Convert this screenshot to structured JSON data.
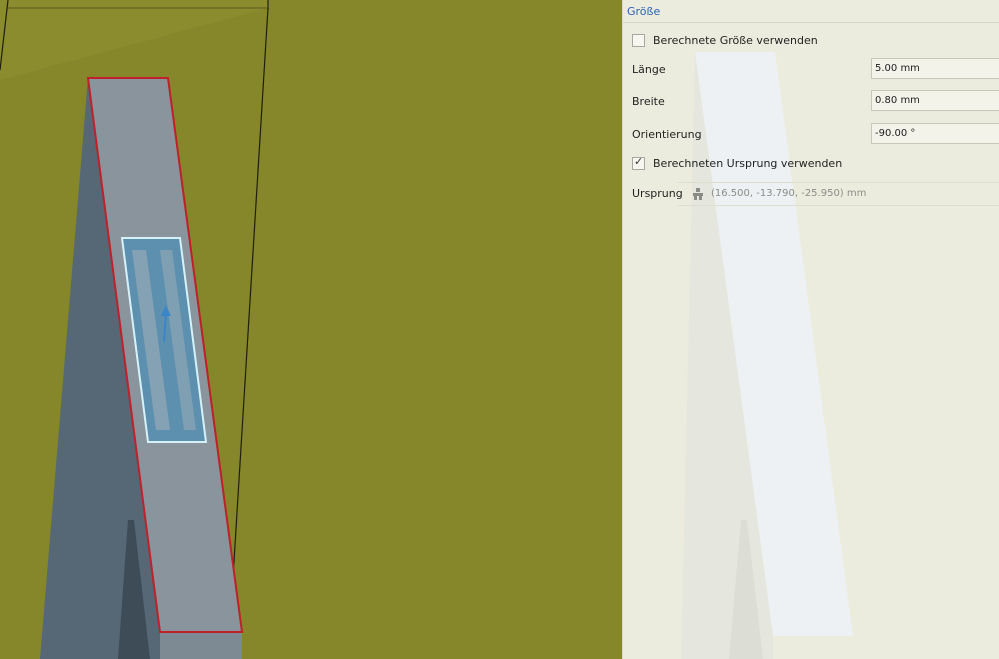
{
  "panel": {
    "section_title": "Größe",
    "use_calculated_size": {
      "label": "Berechnete Größe verwenden",
      "checked": false
    },
    "length": {
      "label": "Länge",
      "value": "5.00 mm"
    },
    "width": {
      "label": "Breite",
      "value": "0.80 mm"
    },
    "orientation": {
      "label": "Orientierung",
      "value": "-90.00 °"
    },
    "use_calculated_origin": {
      "label": "Berechneten Ursprung verwenden",
      "checked": true
    },
    "origin": {
      "label": "Ursprung",
      "value": "(16.500, -13.790, -25.950) mm",
      "icon": "origin-person-icon"
    }
  },
  "colors": {
    "viewport_bg": "#85872a",
    "selection_edge": "#c0202a",
    "pad_highlight": "#bfe8f5",
    "section_title": "#2a62b8",
    "panel_bg": "#ececde"
  }
}
